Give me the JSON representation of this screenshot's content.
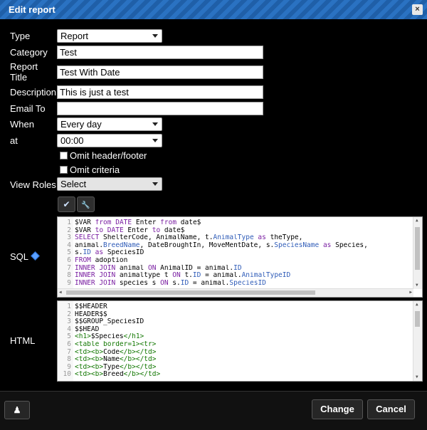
{
  "dialog": {
    "title": "Edit report",
    "close_glyph": "×"
  },
  "form": {
    "type_label": "Type",
    "type_value": "Report",
    "category_label": "Category",
    "category_value": "Test",
    "report_title_label_1": "Report",
    "report_title_label_2": "Title",
    "report_title_value": "Test With Date",
    "description_label": "Description",
    "description_value": "This is just a test",
    "email_label": "Email To",
    "email_value": "",
    "when_label": "When",
    "when_value": "Every day",
    "at_label": "at",
    "at_value": "00:00",
    "omit_header_label": "Omit header/footer",
    "omit_criteria_label": "Omit criteria",
    "view_roles_label": "View Roles",
    "view_roles_value": "Select",
    "sql_label": "SQL",
    "html_label": "HTML"
  },
  "toolbar": {
    "check_glyph": "✔",
    "wrench_glyph": "🔧"
  },
  "sql_lines": [
    "$VAR from DATE Enter from date$",
    "$VAR to DATE Enter to date$",
    "SELECT ShelterCode, AnimalName, t.AnimalType as theType,",
    "animal.BreedName, DateBroughtIn, MoveMentDate, s.SpeciesName as Species,",
    "s.ID as SpeciesID",
    "FROM adoption",
    "INNER JOIN animal ON AnimalID = animal.ID",
    "INNER JOIN animaltype t ON t.ID = animal.AnimalTypeID",
    "INNER JOIN species s ON s.ID = animal.SpeciesID"
  ],
  "html_lines": [
    "$$HEADER",
    "HEADER$$",
    "$$GROUP_SpeciesID",
    "$$HEAD",
    "<h1>$Species</h1>",
    "<table border=1><tr>",
    "<td><b>Code</b></td>",
    "<td><b>Name</b></td>",
    "<td><b>Type</b></td>",
    "<td><b>Breed</b></td>"
  ],
  "footer": {
    "change_label": "Change",
    "cancel_label": "Cancel",
    "left_icon": "users-icon"
  }
}
